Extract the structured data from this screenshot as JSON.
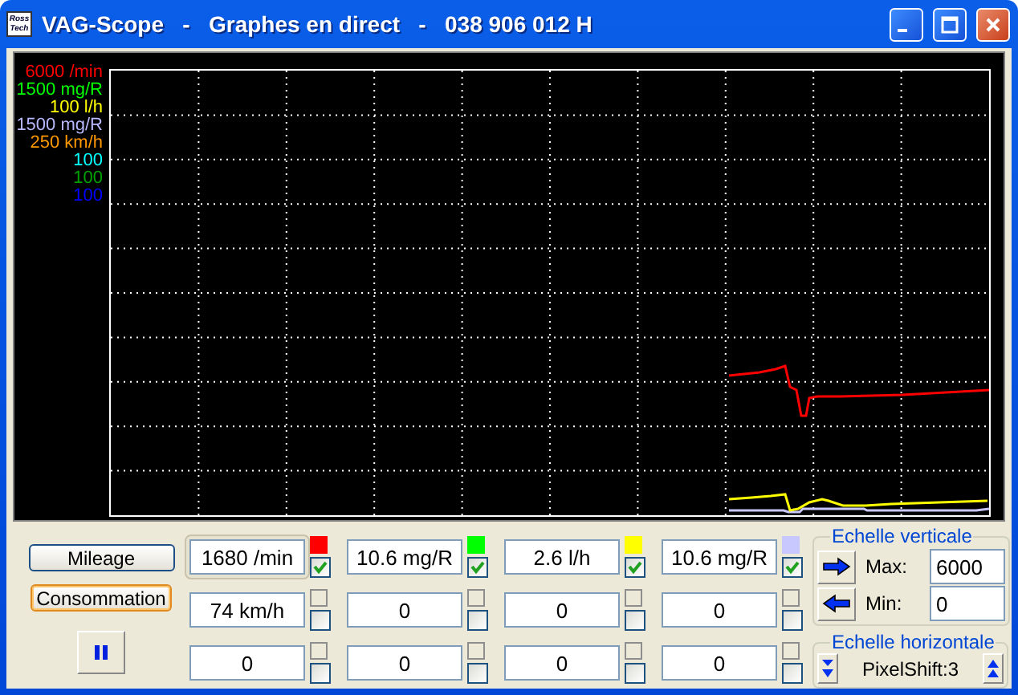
{
  "window": {
    "title": "VAG-Scope   -   Graphes en direct   -   038 906 012 H",
    "icon_text": "Ross Tech"
  },
  "scale_labels": [
    {
      "text": "6000 /min",
      "color": "#ff0000"
    },
    {
      "text": "1500 mg/R",
      "color": "#00ff00"
    },
    {
      "text": "100 l/h",
      "color": "#ffff00"
    },
    {
      "text": "1500 mg/R",
      "color": "#b8b8ff"
    },
    {
      "text": "250 km/h",
      "color": "#ff9900"
    },
    {
      "text": "100",
      "color": "#00ffff"
    },
    {
      "text": "100",
      "color": "#00a000"
    },
    {
      "text": "100",
      "color": "#0000ff"
    }
  ],
  "buttons": [
    {
      "label": "Mileage",
      "selected": false
    },
    {
      "label": "Consommation",
      "selected": true
    }
  ],
  "channels": [
    {
      "value": "1680 /min",
      "color": "#ff0000",
      "checked": true,
      "selected": true
    },
    {
      "value": "10.6 mg/R",
      "color": "#00ff00",
      "checked": true,
      "selected": false
    },
    {
      "value": "2.6 l/h",
      "color": "#ffff00",
      "checked": true,
      "selected": false
    },
    {
      "value": "10.6 mg/R",
      "color": "#c8c8ff",
      "checked": true,
      "selected": false
    },
    {
      "value": "74 km/h",
      "checked": false,
      "selected": false
    },
    {
      "value": "0",
      "checked": false,
      "selected": false
    },
    {
      "value": "0",
      "checked": false,
      "selected": false
    },
    {
      "value": "0",
      "checked": false,
      "selected": false
    },
    {
      "value": "0",
      "checked": false,
      "selected": false
    },
    {
      "value": "0",
      "checked": false,
      "selected": false
    },
    {
      "value": "0",
      "checked": false,
      "selected": false
    },
    {
      "value": "0",
      "checked": false,
      "selected": false
    }
  ],
  "vertical_scale": {
    "title": "Echelle verticale",
    "max_label": "Max:",
    "max_value": "6000",
    "min_label": "Min:",
    "min_value": "0"
  },
  "horizontal_scale": {
    "title": "Echelle horizontale",
    "value": "PixelShift:3"
  }
}
